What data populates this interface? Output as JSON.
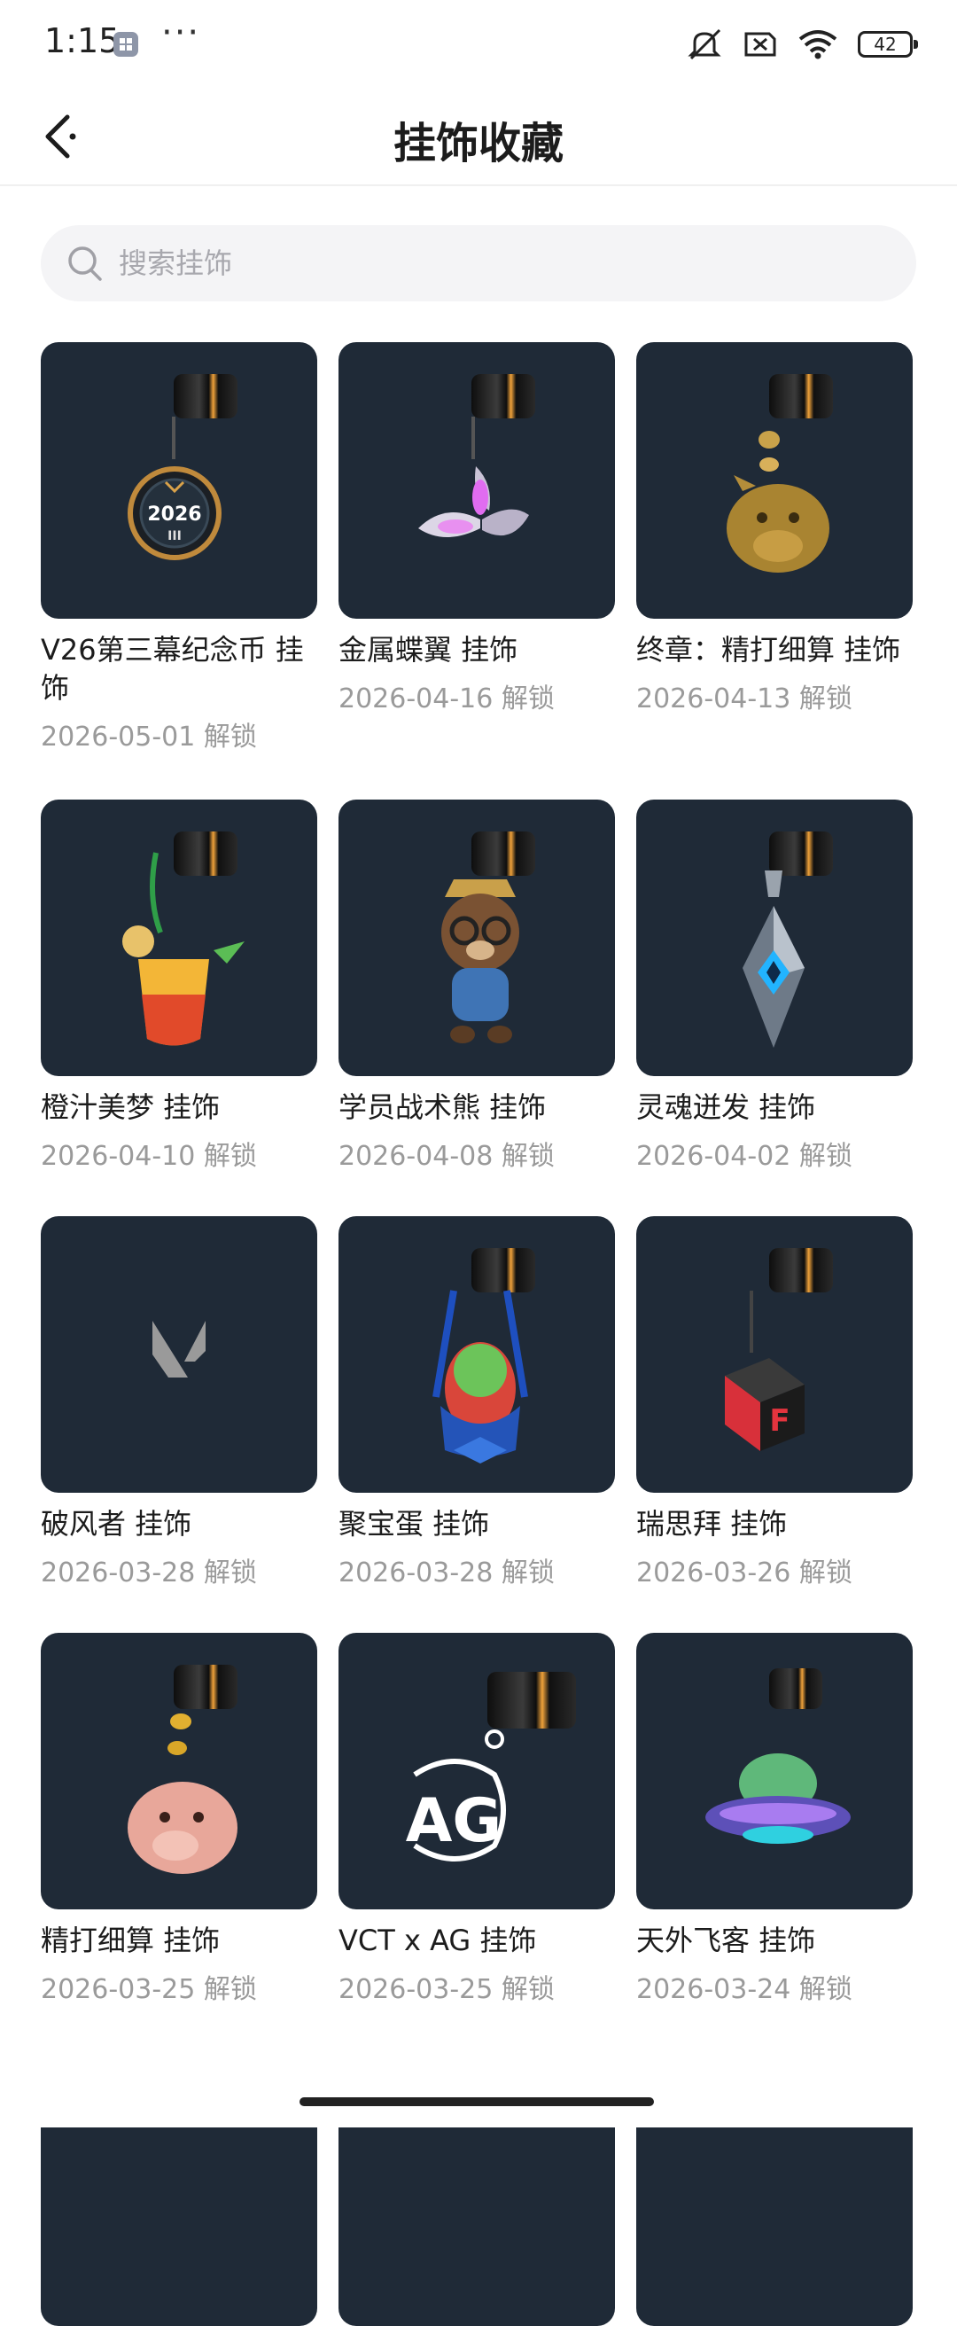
{
  "status": {
    "time": "1:15",
    "battery": "42"
  },
  "header": {
    "title": "挂饰收藏"
  },
  "search": {
    "placeholder": "搜索挂饰"
  },
  "items": [
    {
      "name": "V26第三幕纪念币 挂饰",
      "date": "2026-05-01 解锁"
    },
    {
      "name": "金属蝶翼 挂饰",
      "date": "2026-04-16 解锁"
    },
    {
      "name": "终章：精打细算 挂饰",
      "date": "2026-04-13 解锁"
    },
    {
      "name": "橙汁美梦 挂饰",
      "date": "2026-04-10 解锁"
    },
    {
      "name": "学员战术熊 挂饰",
      "date": "2026-04-08 解锁"
    },
    {
      "name": "灵魂迸发 挂饰",
      "date": "2026-04-02 解锁"
    },
    {
      "name": "破风者 挂饰",
      "date": "2026-03-28 解锁"
    },
    {
      "name": "聚宝蛋 挂饰",
      "date": "2026-03-28 解锁"
    },
    {
      "name": "瑞思拜 挂饰",
      "date": "2026-03-26 解锁"
    },
    {
      "name": "精打细算 挂饰",
      "date": "2026-03-25 解锁"
    },
    {
      "name": "VCT x AG 挂饰",
      "date": "2026-03-25 解锁"
    },
    {
      "name": "天外飞客 挂饰",
      "date": "2026-03-24 解锁"
    }
  ],
  "thumbs": {
    "coin_text": "2026",
    "coin_sub": "III",
    "ag_text": "AG",
    "cube_letter": "F"
  },
  "colors": {
    "thumb_bg": "#1f2a37",
    "accent": "#f0a23a"
  }
}
